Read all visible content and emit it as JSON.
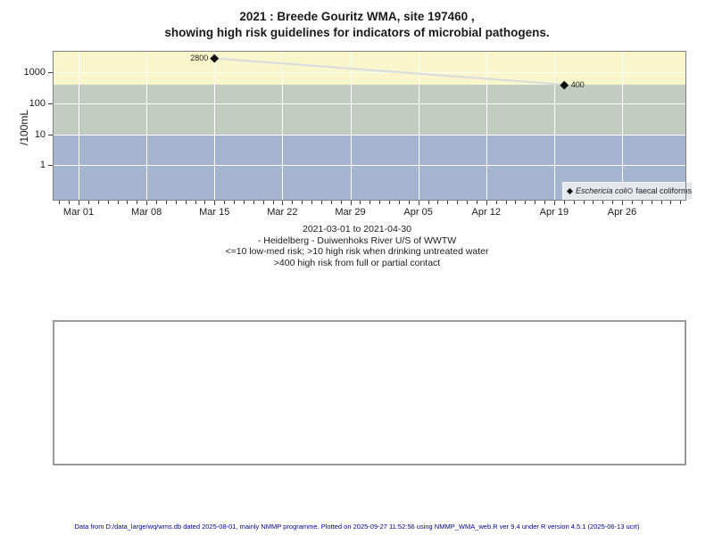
{
  "title": {
    "line1": "2021 : Breede Gouritz WMA, site 197460 ,",
    "line2": "showing high risk guidelines for indicators of microbial pathogens."
  },
  "chart_data": {
    "type": "line",
    "title": "2021 : Breede Gouritz WMA, site 197460, showing high risk guidelines for indicators of microbial pathogens.",
    "xlabel": "",
    "ylabel": "/100mL",
    "y_scale": "log10",
    "ylim": [
      0.072,
      4900
    ],
    "x_start_date": "2021-03-01",
    "x_end_date": "2021-04-30",
    "xlim_days": [
      -2.67,
      62.62
    ],
    "grid": "white gridlines on colored risk bands",
    "y_ticks": [
      {
        "value": 1000,
        "label": "1000"
      },
      {
        "value": 100,
        "label": "100"
      },
      {
        "value": 10,
        "label": "10"
      },
      {
        "value": 1,
        "label": "1"
      }
    ],
    "y_gridlines": [
      1000,
      100,
      10,
      1
    ],
    "x_major_ticks": [
      {
        "day": 0,
        "label": "Mar 01"
      },
      {
        "day": 7,
        "label": "Mar 08"
      },
      {
        "day": 14,
        "label": "Mar 15"
      },
      {
        "day": 21,
        "label": "Mar 22"
      },
      {
        "day": 28,
        "label": "Mar 29"
      },
      {
        "day": 35,
        "label": "Apr 05"
      },
      {
        "day": 42,
        "label": "Apr 12"
      },
      {
        "day": 49,
        "label": "Apr 19"
      },
      {
        "day": 56,
        "label": "Apr 26"
      }
    ],
    "x_minor_tick_every_days": 1,
    "bands": [
      {
        "name": "high-risk-full-or-partial-contact",
        "from": 400,
        "to": 4900,
        "color": "#FAF6CB"
      },
      {
        "name": "high-risk-drinking-untreated-water",
        "from": 10,
        "to": 400,
        "color": "#C2CCC0"
      },
      {
        "name": "low-med-risk",
        "from": 0.072,
        "to": 10,
        "color": "#A5B5CF"
      }
    ],
    "series": [
      {
        "name": "Eschericia coli",
        "marker": "filled-diamond",
        "marker_color": "#111111",
        "line_color": "#DBDBDB",
        "points": [
          {
            "date": "2021-03-15",
            "value": 2800,
            "label": "2800",
            "label_side": "left"
          },
          {
            "date": "2021-04-20",
            "value": 400,
            "label": "400",
            "label_side": "right"
          }
        ]
      },
      {
        "name": "faecal coliforms",
        "marker": "open-circle",
        "marker_color": "#555555",
        "points": []
      }
    ],
    "legend": {
      "position": "bottom-right",
      "entries": [
        {
          "marker": "filled-diamond",
          "label": "Eschericia coli",
          "italic": true
        },
        {
          "marker": "open-circle",
          "label": "faecal coliforms",
          "italic": false
        }
      ]
    }
  },
  "caption": {
    "lines": [
      "2021-03-01 to 2021-04-30",
      "- Heidelberg - Duiwenhoks River U/S of WWTW",
      "<=10 low-med risk; >10 high risk when drinking untreated water",
      ">400 high risk from full or partial contact"
    ]
  },
  "footer": {
    "text": "Data from D:/data_large/wq/wms.db dated 2025-08-01, mainly NMMP programme. Plotted on 2025-09-27 11:52:56 using NMMP_WMA_web.R ver 9.4 under R version 4.5.1 (2025-06-13 ucrt)",
    "color": "#00008B"
  }
}
